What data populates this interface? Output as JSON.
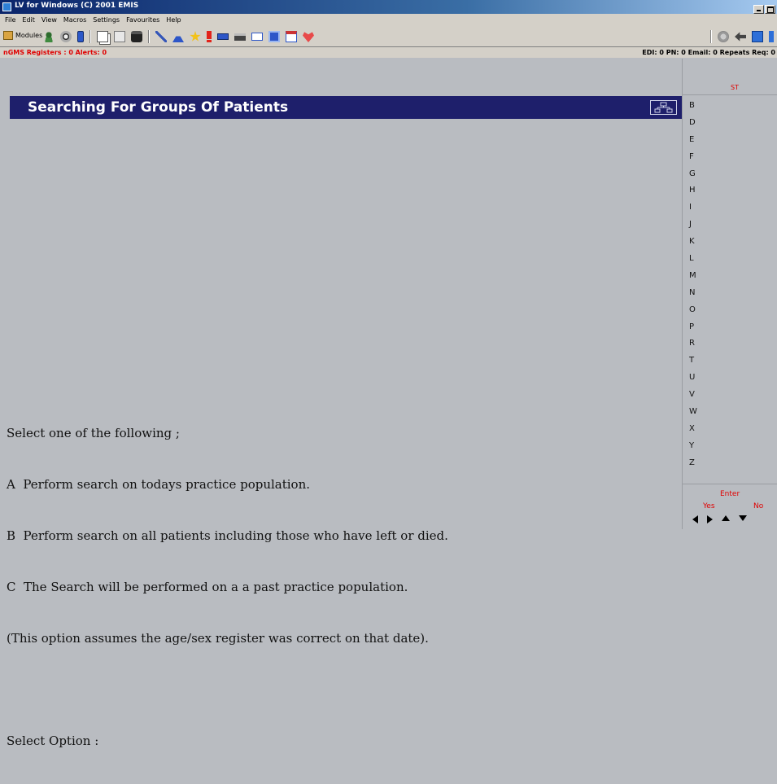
{
  "window": {
    "title": "LV for Windows (C) 2001 EMIS"
  },
  "menu": [
    "File",
    "Edit",
    "View",
    "Macros",
    "Settings",
    "Favourites",
    "Help"
  ],
  "toolbar": {
    "modules_label": "Modules",
    "icons": [
      "patient-icon",
      "globe-icon",
      "battery-icon",
      "copy-icon",
      "paste-icon",
      "save-icon",
      "syringe-icon",
      "flask-icon",
      "star-icon",
      "alert-icon",
      "card-icon",
      "printer-icon",
      "message-icon",
      "letter-icon",
      "calendar-icon",
      "heart-icon"
    ],
    "right_icons": [
      "stop-icon",
      "back-icon",
      "book-icon",
      "help-icon"
    ]
  },
  "status": {
    "left": "nGMS Registers : 0  Alerts: 0",
    "right": "EDI: 0  PN: 0  Email: 0  Repeats Req: 0"
  },
  "colors": {
    "banner": "#1e1f6b",
    "alert_red": "#e00000",
    "background": "#b9bcc1"
  },
  "main": {
    "title": "Searching For Groups Of Patients",
    "prompt": "Select one of the following ;",
    "options": [
      "A  Perform search on todays practice population.",
      "B  Perform search on all patients including those who have left or died.",
      "C  The Search will be performed on a a past practice population."
    ],
    "note": "(This option assumes the age/sex register was correct on that date).",
    "select_prompt": "Select Option :"
  },
  "right_panel": {
    "header": "ST",
    "letters": [
      "B",
      "D",
      "E",
      "F",
      "G",
      "H",
      "I",
      "J",
      "K",
      "L",
      "M",
      "N",
      "O",
      "P",
      "R",
      "T",
      "U",
      "V",
      "W",
      "X",
      "Y",
      "Z"
    ],
    "enter_label": "Enter",
    "yes_label": "Yes",
    "no_label": "No"
  }
}
